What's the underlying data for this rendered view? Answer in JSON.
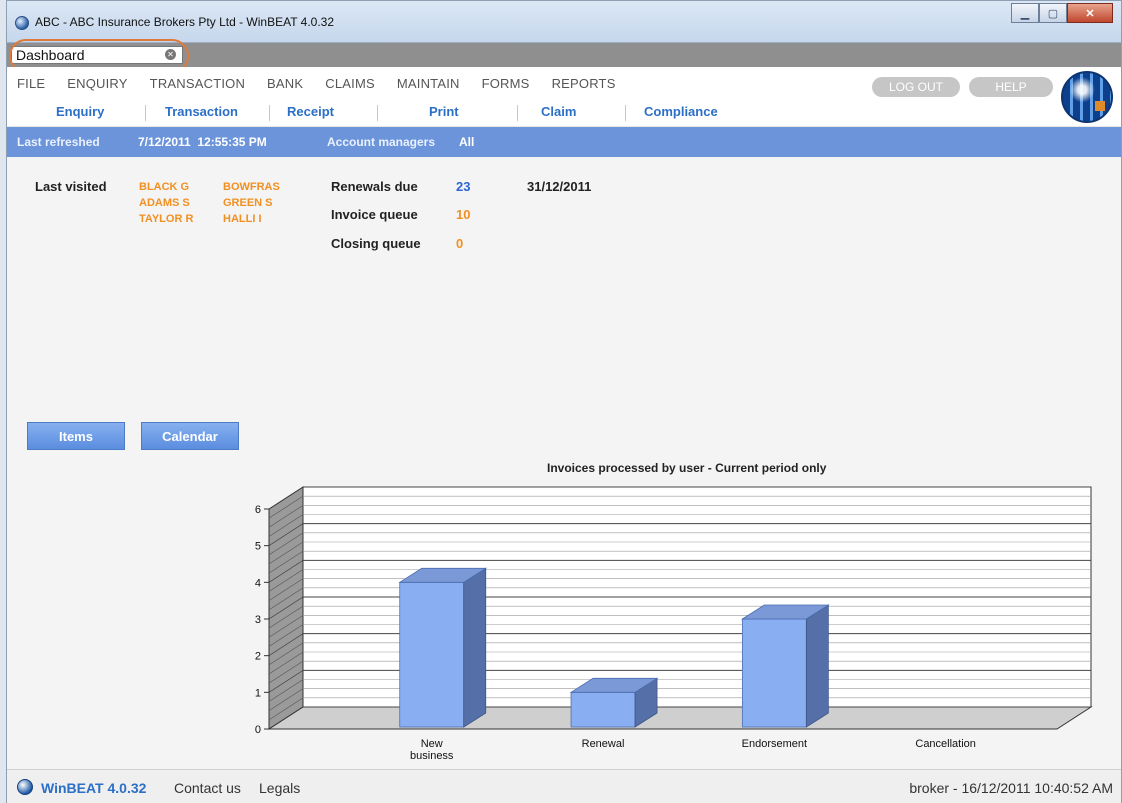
{
  "window": {
    "title": "ABC - ABC Insurance Brokers Pty Ltd - WinBEAT 4.0.32"
  },
  "tab": {
    "label": "Dashboard"
  },
  "menu": {
    "top": [
      "FILE",
      "ENQUIRY",
      "TRANSACTION",
      "BANK",
      "CLAIMS",
      "MAINTAIN",
      "FORMS",
      "REPORTS"
    ],
    "sub": [
      "Enquiry",
      "Transaction",
      "Receipt",
      "Print",
      "Claim",
      "Compliance"
    ],
    "logout": "LOG OUT",
    "help": "HELP"
  },
  "infobar": {
    "last_refreshed_label": "Last refreshed",
    "last_refreshed_value": "7/12/2011  12:55:35 PM",
    "account_managers_label": "Account managers",
    "account_managers_value": "All"
  },
  "dashboard": {
    "last_visited_label": "Last visited",
    "last_visited": [
      "BLACK G",
      "BOWFRAS",
      "ADAMS S",
      "GREEN S",
      "TAYLOR R",
      "HALLI I"
    ],
    "renewals_due_label": "Renewals due",
    "renewals_due_value": "23",
    "renewals_due_date": "31/12/2011",
    "invoice_queue_label": "Invoice queue",
    "invoice_queue_value": "10",
    "closing_queue_label": "Closing queue",
    "closing_queue_value": "0",
    "items_button": "Items",
    "calendar_button": "Calendar"
  },
  "chart_data": {
    "type": "bar",
    "title": "Invoices processed by user - Current period only",
    "categories": [
      "New business",
      "Renewal",
      "Endorsement",
      "Cancellation"
    ],
    "values": [
      4,
      1,
      3,
      0
    ],
    "ylim": [
      0,
      6
    ],
    "yticks": [
      0,
      1,
      2,
      3,
      4,
      5,
      6
    ],
    "bar_color": "#8aaef2",
    "grid": true
  },
  "status": {
    "brand": "WinBEAT 4.0.32",
    "contact": "Contact us",
    "legals": "Legals",
    "user_time": "broker - 16/12/2011 10:40:52 AM"
  }
}
